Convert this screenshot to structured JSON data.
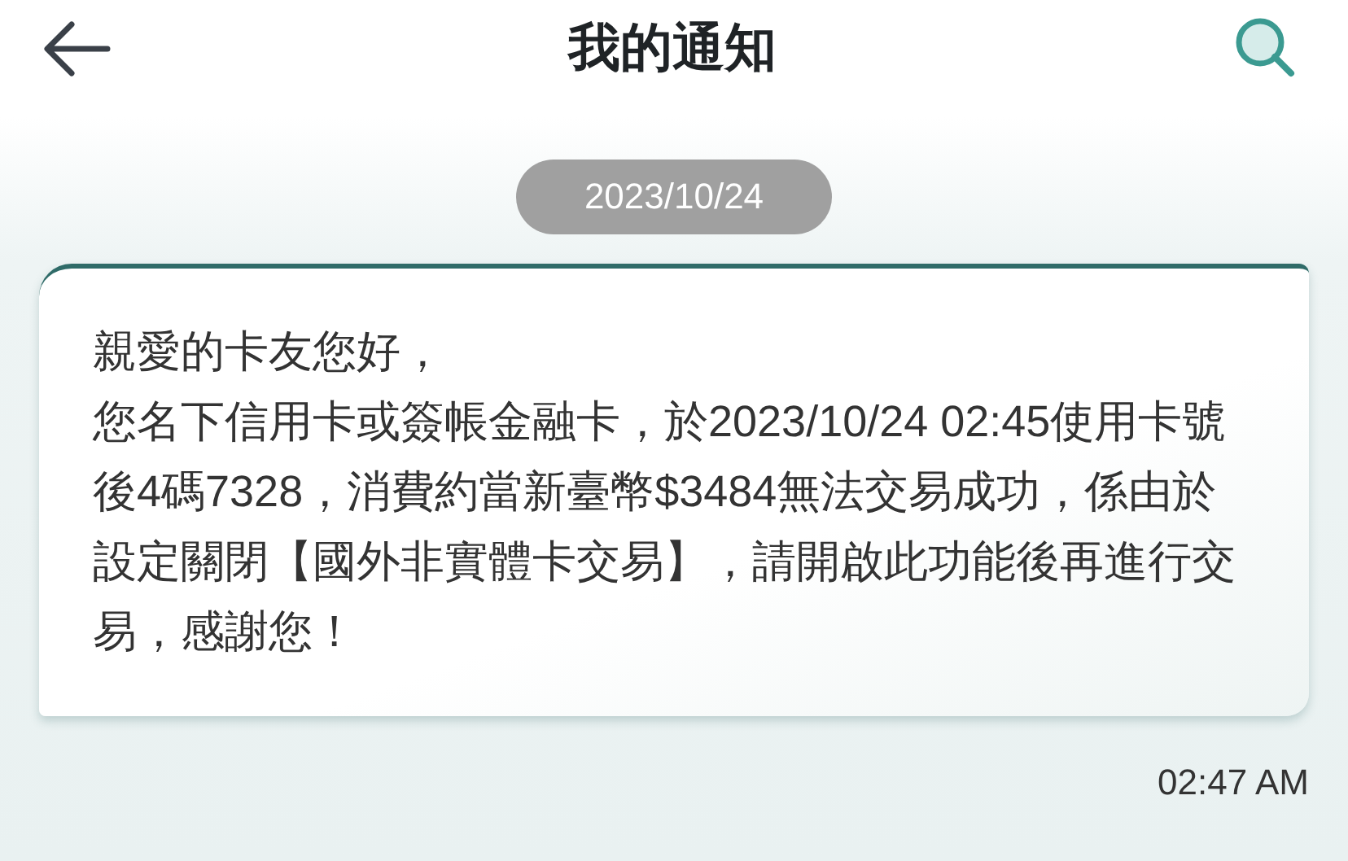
{
  "header": {
    "title": "我的通知"
  },
  "date": "2023/10/24",
  "message": {
    "greeting": "親愛的卡友您好，",
    "body": "您名下信用卡或簽帳金融卡，於2023/10/24 02:45使用卡號後4碼7328，消費約當新臺幣$3484無法交易成功，係由於設定關閉【國外非實體卡交易】，請開啟此功能後再進行交易，感謝您！",
    "time": "02:47 AM"
  }
}
